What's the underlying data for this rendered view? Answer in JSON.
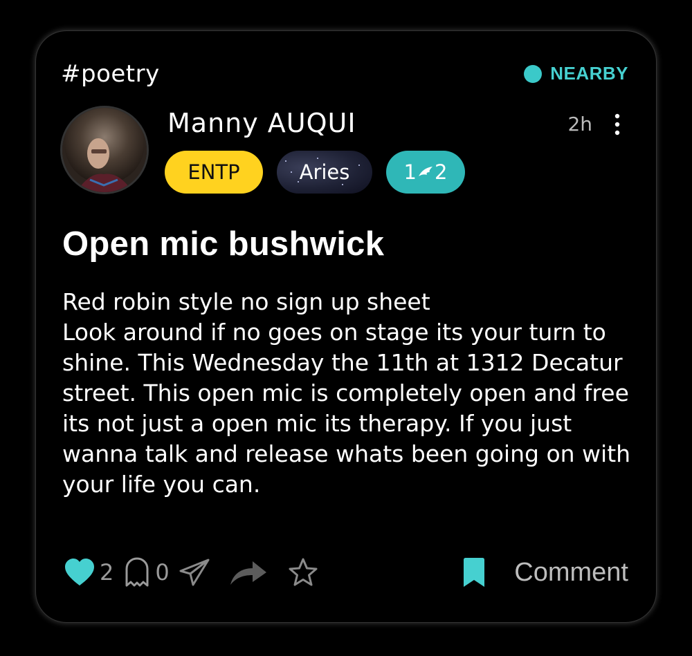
{
  "post": {
    "hashtag": "#poetry",
    "location_badge": "NEARBY",
    "author": "Manny AUQUI",
    "time_ago": "2h",
    "badges": {
      "mbti": "ENTP",
      "zodiac": "Aries",
      "pill_left": "1",
      "pill_right": "2"
    },
    "title": "Open mic bushwick",
    "body": "Red robin style no sign up sheet\nLook around if no goes on stage its your turn to shine. This Wednesday the 11th at 1312 Decatur street. This open mic is completely open and free its not just a open mic its therapy. If you just wanna talk and release whats been going on with your life you can.",
    "actions": {
      "likes": "2",
      "ghost_count": "0",
      "comment_label": "Comment"
    }
  },
  "colors": {
    "accent": "#46d0d0",
    "mbti_badge": "#ffd21f",
    "pill_badge": "#2fb7b7",
    "background": "#000000"
  },
  "icons": [
    "more-vertical-icon",
    "heart-icon",
    "ghost-icon",
    "send-icon",
    "share-icon",
    "star-icon",
    "bookmark-icon"
  ]
}
